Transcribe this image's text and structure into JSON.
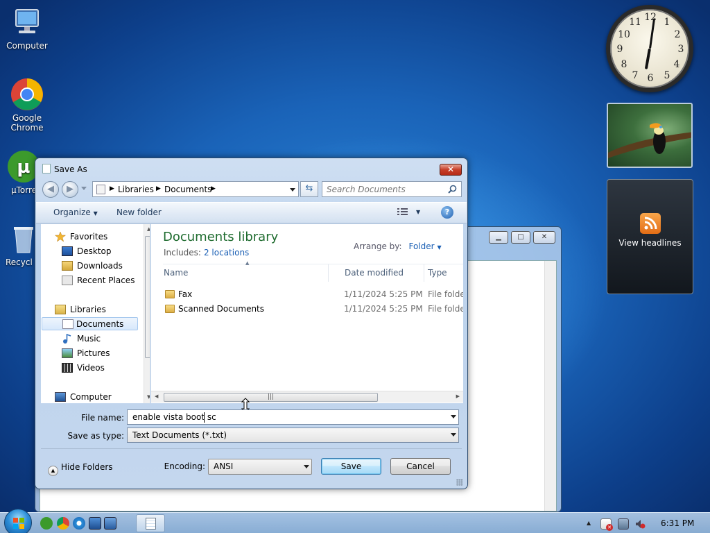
{
  "desktop": {
    "icons": [
      {
        "label": "Computer"
      },
      {
        "label": "Google Chrome"
      },
      {
        "label": "µTorre"
      },
      {
        "label": "Recycl"
      }
    ]
  },
  "gadgets": {
    "clock_numbers": [
      "12",
      "1",
      "2",
      "3",
      "4",
      "5",
      "6",
      "7",
      "8",
      "9",
      "10",
      "11"
    ],
    "feed_label": "View headlines"
  },
  "dialog": {
    "title": "Save As",
    "close_label": "✕",
    "breadcrumb": [
      "Libraries",
      "Documents"
    ],
    "search_placeholder": "Search Documents",
    "toolbar": {
      "organize": "Organize",
      "new_folder": "New folder"
    },
    "nav": {
      "favorites": "Favorites",
      "desktop": "Desktop",
      "downloads": "Downloads",
      "recent_places": "Recent Places",
      "libraries": "Libraries",
      "documents": "Documents",
      "music": "Music",
      "pictures": "Pictures",
      "videos": "Videos",
      "computer": "Computer"
    },
    "library": {
      "title": "Documents library",
      "includes_label": "Includes:",
      "locations_link": "2 locations",
      "arrange_label": "Arrange by:",
      "arrange_value": "Folder"
    },
    "columns": {
      "name": "Name",
      "date": "Date modified",
      "type": "Type"
    },
    "files": [
      {
        "name": "Fax",
        "date": "1/11/2024 5:25 PM",
        "type": "File folder"
      },
      {
        "name": "Scanned Documents",
        "date": "1/11/2024 5:25 PM",
        "type": "File folder"
      }
    ],
    "file_name_label": "File name:",
    "file_name_value": "enable vista boot sc",
    "save_type_label": "Save as type:",
    "save_type_value": "Text Documents (*.txt)",
    "hide_folders": "Hide Folders",
    "encoding_label": "Encoding:",
    "encoding_value": "ANSI",
    "save_button": "Save",
    "cancel_button": "Cancel"
  },
  "taskbar": {
    "time": "6:31 PM"
  }
}
